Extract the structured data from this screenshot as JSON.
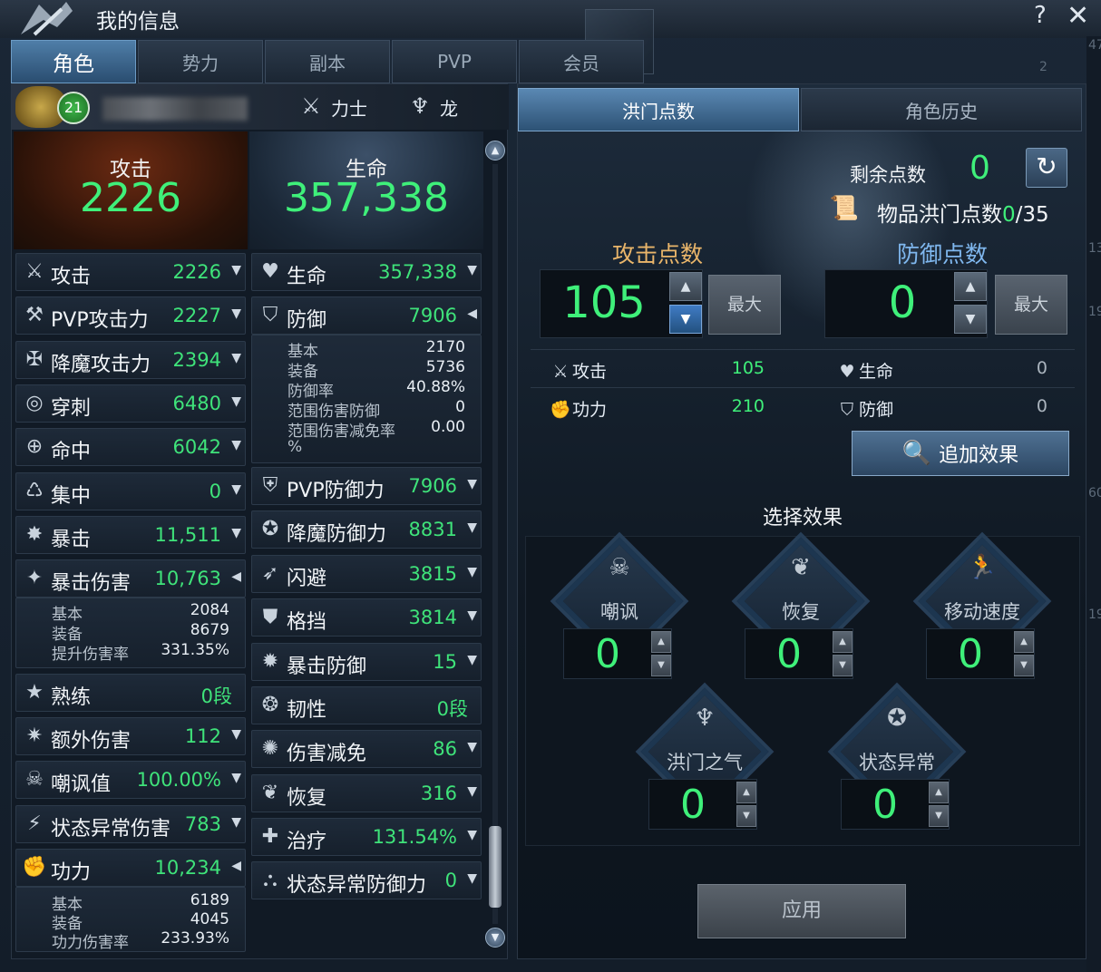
{
  "window": {
    "title": "我的信息",
    "help": "?",
    "close": "✕"
  },
  "tabs": [
    "角色",
    "势力",
    "副本",
    "PVP",
    "会员"
  ],
  "char": {
    "level": "21",
    "class_name": "力士",
    "race": "龙"
  },
  "summary": {
    "attack_label": "攻击",
    "attack_value": "2226",
    "hp_label": "生命",
    "hp_value": "357,338"
  },
  "left_stats": [
    {
      "label": "攻击",
      "value": "2226",
      "icon": "crossed-swords-icon"
    },
    {
      "label": "PVP攻击力",
      "value": "2227",
      "icon": "pvp-attack-icon"
    },
    {
      "label": "降魔攻击力",
      "value": "2394",
      "icon": "demon-attack-icon"
    },
    {
      "label": "穿刺",
      "value": "6480",
      "icon": "pierce-icon"
    },
    {
      "label": "命中",
      "value": "6042",
      "icon": "crosshair-icon"
    },
    {
      "label": "集中",
      "value": "0",
      "icon": "focus-icon"
    },
    {
      "label": "暴击",
      "value": "11,511",
      "icon": "critical-icon"
    },
    {
      "label": "暴击伤害",
      "value": "10,763",
      "icon": "critical-damage-icon"
    },
    {
      "label": "熟练",
      "value": "0段",
      "icon": "mastery-icon"
    },
    {
      "label": "额外伤害",
      "value": "112",
      "icon": "extra-damage-icon"
    },
    {
      "label": "嘲讽值",
      "value": "100.00%",
      "icon": "skull-icon"
    },
    {
      "label": "状态异常伤害",
      "value": "783",
      "icon": "debuff-damage-icon"
    },
    {
      "label": "功力",
      "value": "10,234",
      "icon": "power-fist-icon"
    }
  ],
  "crit_detail": [
    {
      "k": "基本",
      "v": "2084"
    },
    {
      "k": "装备",
      "v": "8679"
    },
    {
      "k": "提升伤害率",
      "v": "331.35%"
    }
  ],
  "power_detail": [
    {
      "k": "基本",
      "v": "6189"
    },
    {
      "k": "装备",
      "v": "4045"
    },
    {
      "k": "功力伤害率",
      "v": "233.93%"
    }
  ],
  "right_stats": [
    {
      "label": "生命",
      "value": "357,338",
      "icon": "heart-icon"
    },
    {
      "label": "防御",
      "value": "7906",
      "icon": "shield-icon"
    },
    {
      "label": "PVP防御力",
      "value": "7906",
      "icon": "pvp-defense-icon"
    },
    {
      "label": "降魔防御力",
      "value": "8831",
      "icon": "demon-defense-icon"
    },
    {
      "label": "闪避",
      "value": "3815",
      "icon": "evade-icon"
    },
    {
      "label": "格挡",
      "value": "3814",
      "icon": "block-icon"
    },
    {
      "label": "暴击防御",
      "value": "15",
      "icon": "crit-defense-icon"
    },
    {
      "label": "韧性",
      "value": "0段",
      "icon": "toughness-icon"
    },
    {
      "label": "伤害减免",
      "value": "86",
      "icon": "damage-reduction-icon"
    },
    {
      "label": "恢复",
      "value": "316",
      "icon": "sprout-icon"
    },
    {
      "label": "治疗",
      "value": "131.54%",
      "icon": "heal-icon"
    },
    {
      "label": "状态异常防御力",
      "value": "0",
      "icon": "debuff-defense-icon"
    }
  ],
  "def_detail": [
    {
      "k": "基本",
      "v": "2170"
    },
    {
      "k": "装备",
      "v": "5736"
    },
    {
      "k": "防御率",
      "v": "40.88%"
    },
    {
      "k": "范围伤害防御",
      "v": "0"
    },
    {
      "k": "范围伤害减免率",
      "v": "0.00"
    },
    {
      "k": "%",
      "v": ""
    }
  ],
  "hongmen": {
    "tab_points": "洪门点数",
    "tab_history": "角色历史",
    "remain_label": "剩余点数",
    "remain_value": "0",
    "item_label": "物品洪门点数",
    "item_current": "0",
    "item_max": "/35",
    "attack_title": "攻击点数",
    "defense_title": "防御点数",
    "attack_points": "105",
    "defense_points": "0",
    "max_label": "最大",
    "gains": [
      {
        "label": "攻击",
        "value": "105"
      },
      {
        "label": "功力",
        "value": "210"
      },
      {
        "label": "生命",
        "value": "0"
      },
      {
        "label": "防御",
        "value": "0"
      }
    ],
    "add_effect": "追加效果",
    "choose_effect": "选择效果",
    "effects": [
      {
        "label": "嘲讽",
        "value": "0"
      },
      {
        "label": "恢复",
        "value": "0"
      },
      {
        "label": "移动速度",
        "value": "0"
      },
      {
        "label": "洪门之气",
        "value": "0"
      },
      {
        "label": "状态异常",
        "value": "0"
      }
    ],
    "apply": "应用"
  },
  "edge_numbers": [
    "47",
    "2",
    "13",
    "19",
    "60",
    "19"
  ],
  "colors": {
    "value_green": "#3ff07a",
    "attack_title": "#e9b56a",
    "defense_title": "#7fb7ee",
    "tab_active": "#4f7ea8"
  }
}
